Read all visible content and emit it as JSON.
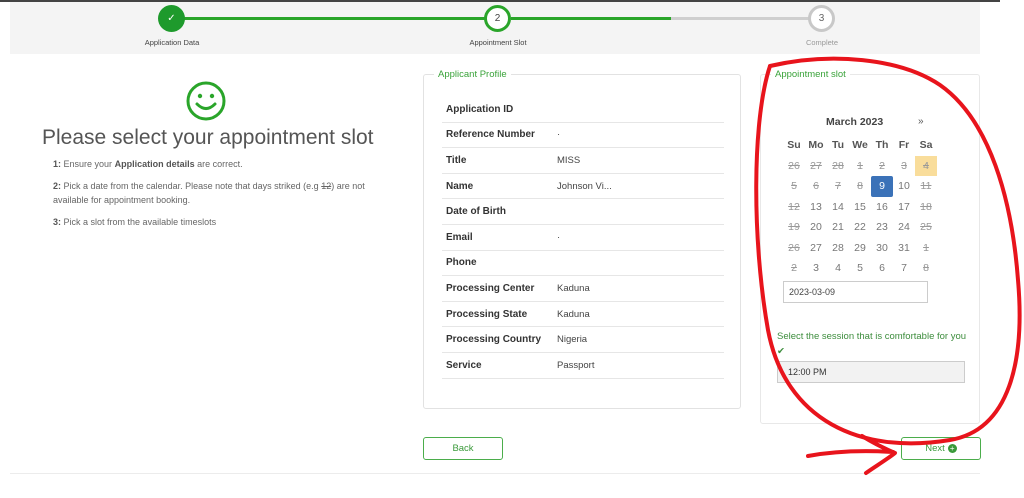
{
  "stepper": {
    "steps": [
      {
        "number": "✓",
        "label": "Application Data",
        "state": "done"
      },
      {
        "number": "2",
        "label": "Appointment Slot",
        "state": "active"
      },
      {
        "number": "3",
        "label": "Complete",
        "state": "pending"
      }
    ],
    "accent": "#2aa52a"
  },
  "instructions": {
    "heading": "Please select your appointment slot",
    "step1_num": "1:",
    "step1_pre": "Ensure your",
    "step1_bold": "Application details",
    "step1_post": "are correct.",
    "step2_num": "2:",
    "step2_pre": "Pick a date from the calendar. Please note that days striked (e.g",
    "step2_strike": "12",
    "step2_post": ") are not available for appointment booking.",
    "step3_num": "3:",
    "step3_text": "Pick a slot from the available timeslots"
  },
  "profile": {
    "legend": "Applicant Profile",
    "rows": [
      {
        "key": "Application ID",
        "value": ""
      },
      {
        "key": "Reference Number",
        "value": "·"
      },
      {
        "key": "Title",
        "value": "MISS"
      },
      {
        "key": "Name",
        "value": "Johnson Vi..."
      },
      {
        "key": "Date of Birth",
        "value": ""
      },
      {
        "key": "Email",
        "value": "·"
      },
      {
        "key": "Phone",
        "value": ""
      },
      {
        "key": "Processing Center",
        "value": "Kaduna"
      },
      {
        "key": "Processing State",
        "value": "Kaduna"
      },
      {
        "key": "Processing Country",
        "value": "Nigeria"
      },
      {
        "key": "Service",
        "value": "Passport"
      }
    ]
  },
  "slot": {
    "legend": "Appointment slot",
    "month": "March 2023",
    "next": "»",
    "weekdays": [
      "Su",
      "Mo",
      "Tu",
      "We",
      "Th",
      "Fr",
      "Sa"
    ],
    "days": [
      {
        "d": "26",
        "s": "struck"
      },
      {
        "d": "27",
        "s": "struck"
      },
      {
        "d": "28",
        "s": "struck"
      },
      {
        "d": "1",
        "s": "struck"
      },
      {
        "d": "2",
        "s": "struck"
      },
      {
        "d": "3",
        "s": "struck"
      },
      {
        "d": "4",
        "s": "struck today"
      },
      {
        "d": "5",
        "s": "struck"
      },
      {
        "d": "6",
        "s": "struck"
      },
      {
        "d": "7",
        "s": "struck"
      },
      {
        "d": "8",
        "s": "struck"
      },
      {
        "d": "9",
        "s": "sel"
      },
      {
        "d": "10",
        "s": ""
      },
      {
        "d": "11",
        "s": "struck"
      },
      {
        "d": "12",
        "s": "struck"
      },
      {
        "d": "13",
        "s": ""
      },
      {
        "d": "14",
        "s": ""
      },
      {
        "d": "15",
        "s": ""
      },
      {
        "d": "16",
        "s": ""
      },
      {
        "d": "17",
        "s": ""
      },
      {
        "d": "18",
        "s": "struck"
      },
      {
        "d": "19",
        "s": "struck"
      },
      {
        "d": "20",
        "s": ""
      },
      {
        "d": "21",
        "s": ""
      },
      {
        "d": "22",
        "s": ""
      },
      {
        "d": "23",
        "s": ""
      },
      {
        "d": "24",
        "s": ""
      },
      {
        "d": "25",
        "s": "struck"
      },
      {
        "d": "26",
        "s": "struck"
      },
      {
        "d": "27",
        "s": ""
      },
      {
        "d": "28",
        "s": ""
      },
      {
        "d": "29",
        "s": ""
      },
      {
        "d": "30",
        "s": ""
      },
      {
        "d": "31",
        "s": ""
      },
      {
        "d": "1",
        "s": "struck"
      },
      {
        "d": "2",
        "s": "struck"
      },
      {
        "d": "3",
        "s": ""
      },
      {
        "d": "4",
        "s": ""
      },
      {
        "d": "5",
        "s": ""
      },
      {
        "d": "6",
        "s": ""
      },
      {
        "d": "7",
        "s": ""
      },
      {
        "d": "8",
        "s": "struck"
      }
    ],
    "selected_date": "2023-03-09",
    "session_label": "Select the session that is comfortable for you",
    "session_check": "✔",
    "session_value": "12:00 PM"
  },
  "buttons": {
    "back": "Back",
    "next": "Next",
    "next_icon": "+"
  },
  "colors": {
    "accent": "#2aa52a",
    "annotation": "#e8141c",
    "selected_day": "#3b72b8",
    "today": "#f9dd9b"
  }
}
